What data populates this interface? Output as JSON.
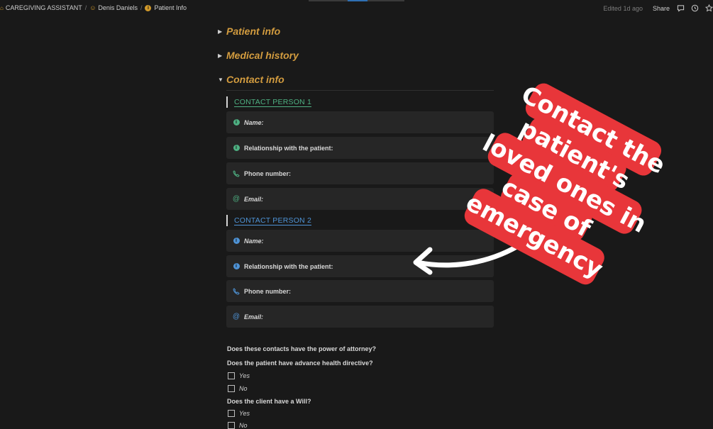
{
  "breadcrumb": {
    "workspace": "CAREGIVING ASSISTANT",
    "person": "Denis Daniels",
    "page": "Patient Info"
  },
  "toolbar": {
    "edited": "Edited 1d ago",
    "share": "Share",
    "icons": [
      "comment-icon",
      "clock-icon",
      "star-icon"
    ]
  },
  "toggles": [
    {
      "label": "Patient info",
      "expanded": false
    },
    {
      "label": "Medical history",
      "expanded": false
    },
    {
      "label": "Contact info",
      "expanded": true
    }
  ],
  "contact1": {
    "heading": "CONTACT PERSON 1",
    "name": "Name:",
    "relationship": "Relationship with the patient:",
    "phone": "Phone number:",
    "email": "Email:"
  },
  "contact2": {
    "heading": "CONTACT PERSON 2",
    "name": "Name:",
    "relationship": "Relationship with the patient:",
    "phone": "Phone number:",
    "email": "Email:"
  },
  "questions": {
    "power": "Does these contacts have the power of attorney?",
    "directive": "Does the patient have advance health directive?",
    "directive_yes": "Yes",
    "directive_no": "No",
    "will": "Does the client have a Will?",
    "will_yes": "Yes",
    "will_no": "No"
  },
  "callout": {
    "lines": [
      "Contact the",
      "patient's",
      "loved ones in",
      "case of",
      "emergency"
    ],
    "color": "#e8363a"
  },
  "colors": {
    "accent_title": "#d39c3f",
    "contact1": "#4eb082",
    "contact2": "#4e93d6"
  }
}
